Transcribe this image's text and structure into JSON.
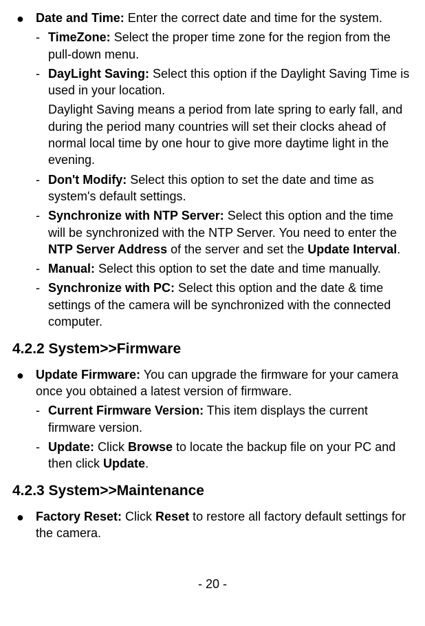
{
  "section1": {
    "item1": {
      "label": "Date and Time:",
      "text": " Enter the correct date and time for the system.",
      "subs": [
        {
          "label": "TimeZone:",
          "text": " Select the proper time zone for the region from the pull-down menu."
        },
        {
          "label": "DayLight Saving:",
          "text": " Select this option if the Daylight Saving Time is used in your location.",
          "para": "Daylight Saving means a period from late spring to early fall, and during the period many countries will set their clocks ahead of normal local time by one hour to give more daytime light in the evening."
        },
        {
          "label": "Don't Modify:",
          "text": " Select this option to set the date and time as system's default settings."
        },
        {
          "label": "Synchronize with NTP Server:",
          "text_before": " Select this option and the time will be synchronized with the NTP Server. You need to enter the ",
          "bold1": "NTP Server Address",
          "text_mid": " of the server and set the ",
          "bold2": "Update Interval",
          "text_after": "."
        },
        {
          "label": "Manual:",
          "text": " Select this option to set the date and time manually."
        },
        {
          "label": "Synchronize with PC:",
          "text": " Select this option and the date & time settings of the camera will be synchronized with the connected computer."
        }
      ]
    }
  },
  "heading2": "4.2.2 System>>Firmware",
  "section2": {
    "item1": {
      "label": "Update Firmware:",
      "text": " You can upgrade the firmware for your camera once you obtained a latest version of firmware.",
      "subs": [
        {
          "label": "Current Firmware Version:",
          "text": " This item displays the current firmware version."
        },
        {
          "label": "Update:",
          "text_before": " Click ",
          "bold1": "Browse",
          "text_mid": " to locate the backup file on your PC and then click ",
          "bold2": "Update",
          "text_after": "."
        }
      ]
    }
  },
  "heading3": "4.2.3 System>>Maintenance",
  "section3": {
    "item1": {
      "label": "Factory Reset:",
      "text_before": " Click ",
      "bold1": "Reset",
      "text_after": " to restore all factory default settings for the camera."
    }
  },
  "pagenum": "- 20 -"
}
